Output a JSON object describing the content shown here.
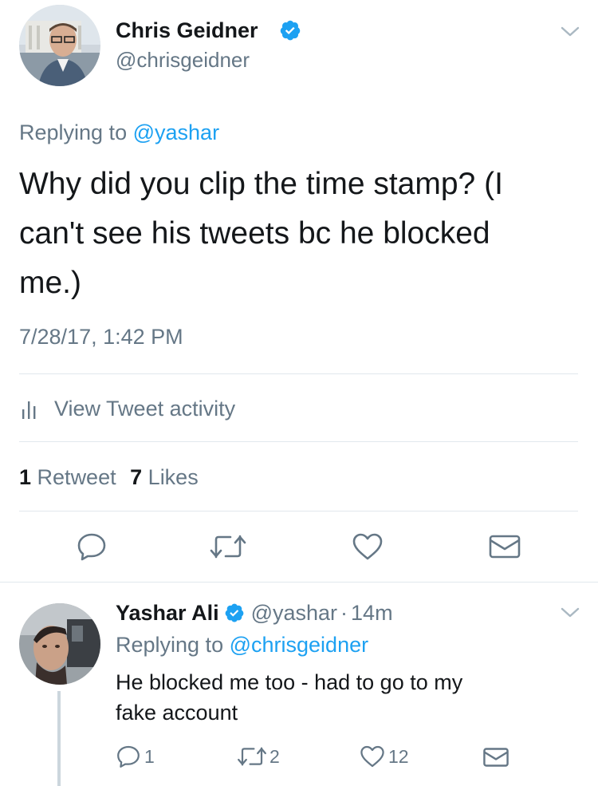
{
  "main_tweet": {
    "author_name": "Chris Geidner",
    "author_handle": "@chrisgeidner",
    "replying_prefix": "Replying to",
    "replying_to": "@yashar",
    "text_line1": "Why did you clip the time stamp? (I",
    "text_line2": "can't see his tweets bc he blocked",
    "text_line3": "me.)",
    "timestamp": "7/28/17, 1:42 PM",
    "activity_label": "View Tweet activity",
    "retweet_count": "1",
    "retweet_label": "Retweet",
    "like_count": "7",
    "like_label": "Likes"
  },
  "reply_tweet": {
    "author_name": "Yashar Ali",
    "author_handle": "@yashar",
    "separator": "·",
    "time_ago": "14m",
    "replying_prefix": "Replying to",
    "replying_to": "@chrisgeidner",
    "text_line1": "He blocked me too - had to go to my",
    "text_line2": "fake account",
    "reply_count": "1",
    "retweet_count": "2",
    "like_count": "12"
  },
  "icons": {
    "verified": "verified-badge-icon",
    "chevron": "chevron-down-icon",
    "reply": "reply-icon",
    "retweet": "retweet-icon",
    "like": "heart-icon",
    "dm": "envelope-icon",
    "activity": "bar-chart-icon"
  },
  "colors": {
    "accent": "#1da1f2",
    "muted": "#657786",
    "text": "#14171a",
    "divider": "#e1e8ed"
  }
}
